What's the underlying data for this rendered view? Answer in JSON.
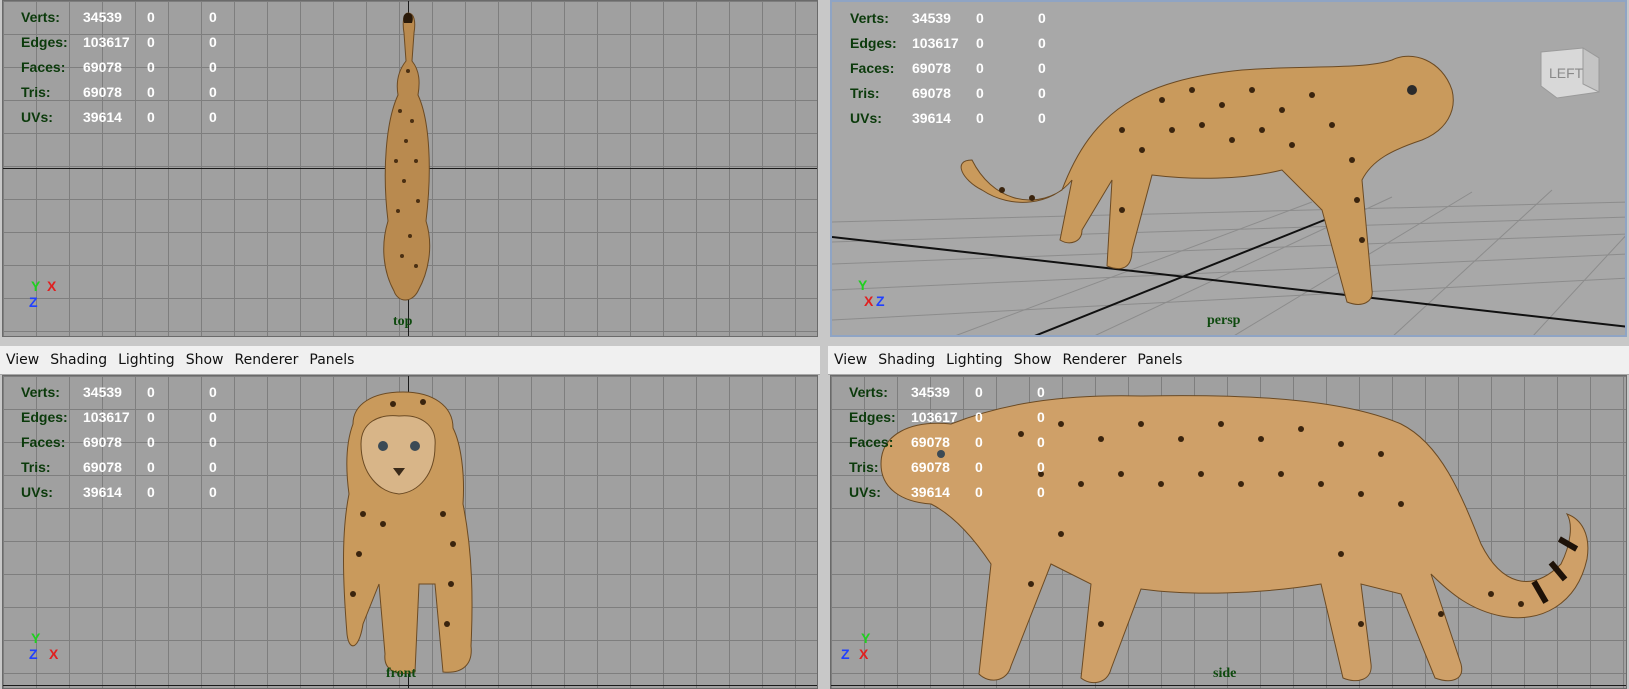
{
  "menu": [
    "View",
    "Shading",
    "Lighting",
    "Show",
    "Renderer",
    "Panels"
  ],
  "hud": {
    "rows": [
      {
        "label": "Verts:",
        "v1": "34539",
        "v2": "0",
        "v3": "0"
      },
      {
        "label": "Edges:",
        "v1": "103617",
        "v2": "0",
        "v3": "0"
      },
      {
        "label": "Faces:",
        "v1": "69078",
        "v2": "0",
        "v3": "0"
      },
      {
        "label": "Tris:",
        "v1": "69078",
        "v2": "0",
        "v3": "0"
      },
      {
        "label": "UVs:",
        "v1": "39614",
        "v2": "0",
        "v3": "0"
      }
    ]
  },
  "viewports": {
    "top": {
      "camera": "top"
    },
    "persp": {
      "camera": "persp"
    },
    "front": {
      "camera": "front"
    },
    "side": {
      "camera": "side"
    }
  },
  "view_cube": {
    "label": "LEFT"
  },
  "axes": {
    "x": "X",
    "y": "Y",
    "z": "Z"
  },
  "colors": {
    "viewport_bg": "#a0a0a0",
    "grid": "#7e7e7e",
    "hud_label": "#0b3a0b",
    "hud_value": "#ffffff",
    "axis_x": "#e02020",
    "axis_y": "#20d020",
    "axis_z": "#2040ff",
    "active_border": "#8fa4c4"
  }
}
